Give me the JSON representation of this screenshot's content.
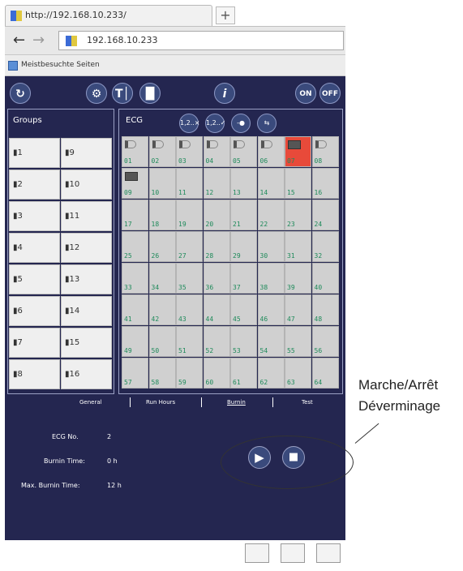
{
  "browser": {
    "tab_title": "http://192.168.10.233/",
    "newtab_label": "+",
    "back": "←",
    "forward": "→",
    "address": "192.168.10.233",
    "bookmark_label": "Meistbesuchte Seiten"
  },
  "toolbar": {
    "refresh": "↻",
    "groups_btn": "⚙",
    "ti_btn": "T│",
    "ii_btn": "▐▌",
    "info_btn": "i",
    "on_label": "ON",
    "off_label": "OFF"
  },
  "groups": {
    "title": "Groups",
    "items": [
      "▮1",
      "▮9",
      "▮2",
      "▮10",
      "▮3",
      "▮11",
      "▮4",
      "▮12",
      "▮5",
      "▮13",
      "▮6",
      "▮14",
      "▮7",
      "▮15",
      "▮8",
      "▮16"
    ]
  },
  "ecg": {
    "title": "ECG",
    "buttons": [
      "1,2..×",
      "1,2..✓",
      "-●",
      "⇆"
    ],
    "cells": [
      "01",
      "02",
      "03",
      "04",
      "05",
      "06",
      "07",
      "08",
      "09",
      "10",
      "11",
      "12",
      "13",
      "14",
      "15",
      "16",
      "17",
      "18",
      "19",
      "20",
      "21",
      "22",
      "23",
      "24",
      "25",
      "26",
      "27",
      "28",
      "29",
      "30",
      "31",
      "32",
      "33",
      "34",
      "35",
      "36",
      "37",
      "38",
      "39",
      "40",
      "41",
      "42",
      "43",
      "44",
      "45",
      "46",
      "47",
      "48",
      "49",
      "50",
      "51",
      "52",
      "53",
      "54",
      "55",
      "56",
      "57",
      "58",
      "59",
      "60",
      "61",
      "62",
      "63",
      "64"
    ],
    "active_cell": "07",
    "lamp_cells": [
      "01",
      "02",
      "03",
      "04",
      "05",
      "06",
      "08"
    ],
    "module_cells": [
      "07",
      "09"
    ]
  },
  "tabs": {
    "general": "General",
    "run_hours": "Run Hours",
    "burnin": "Burnin",
    "test": "Test"
  },
  "details": {
    "ecg_no_label": "ECG No.",
    "ecg_no_value": "2",
    "burnin_time_label": "Burnin Time:",
    "burnin_time_value": "0 h",
    "max_burnin_label": "Max. Burnin Time:",
    "max_burnin_value": "12 h"
  },
  "controls": {
    "play": "▶",
    "stop": "■"
  },
  "annotation": {
    "line1": "Marche/Arrêt",
    "line2": "Déverminage"
  },
  "colors": {
    "app_bg": "#242650",
    "active_cell": "#e84a3a",
    "cell_number": "#1e8a5a"
  }
}
